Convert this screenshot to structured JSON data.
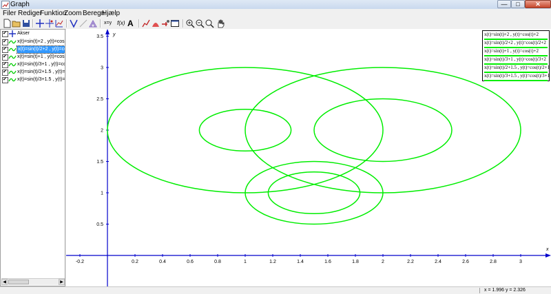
{
  "window": {
    "title": "Graph",
    "min_glyph": "—",
    "max_glyph": "□",
    "close_glyph": "✕"
  },
  "menu": [
    "Filer",
    "Rediger",
    "Funktion",
    "Zoom",
    "Beregn",
    "Hjælp"
  ],
  "toolbar": {
    "text_xy": "x=y",
    "text_fx": "f(x)",
    "text_A": "A",
    "icons": [
      "new-file-icon",
      "open-folder-icon",
      "save-icon",
      "insert-axes-icon",
      "insert-point-icon",
      "insert-series-icon",
      "insert-function-icon",
      "insert-tangent-icon",
      "insert-shading-icon",
      "insert-relation-icon",
      "insert-fx-icon",
      "insert-label-icon",
      "graph-icon",
      "area-icon",
      "pointer-icon",
      "table-icon",
      "zoom-in-icon",
      "zoom-out-icon",
      "zoom-fit-icon",
      "pan-hand-icon"
    ]
  },
  "sidebar": {
    "items": [
      {
        "label": "Akser",
        "type": "axes",
        "checked": true,
        "selected": false
      },
      {
        "label": "x(t)=sin(t)+2 , y(t)=cos(t)+2",
        "type": "function",
        "checked": true,
        "selected": false
      },
      {
        "label": "x(t)=sin(t)/2+2 , y(t)=cos(t)/2+2",
        "type": "function",
        "checked": true,
        "selected": true
      },
      {
        "label": "x(t)=sin(t)+1 , y(t)=cos(t)+2",
        "type": "function",
        "checked": true,
        "selected": false
      },
      {
        "label": "x(t)=sin(t)/3+1 , y(t)=cos(t)/3+2",
        "type": "function",
        "checked": true,
        "selected": false
      },
      {
        "label": "x(t)=sin(t)/2+1.5 , y(t)=cos(t)/2+1",
        "type": "function",
        "checked": true,
        "selected": false
      },
      {
        "label": "x(t)=sin(t)/3+1.5 , y(t)=cos(t)/3+1",
        "type": "function",
        "checked": true,
        "selected": false
      }
    ]
  },
  "legend": [
    "x(t)=sin(t)+2 , y(t)=cos(t)+2",
    "x(t)=sin(t)/2+2 , y(t)=cos(t)/2+2",
    "x(t)=sin(t)+1 , y(t)=cos(t)+2",
    "x(t)=sin(t)/3+1 , y(t)=cos(t)/3+2",
    "x(t)=sin(t)/2+1.5 , y(t)=cos(t)/2+1",
    "x(t)=sin(t)/3+1.5 , y(t)=cos(t)/3+1"
  ],
  "status": {
    "coords": "x = 1.996   y = 2.326"
  },
  "colors": {
    "curve": "#00ee00",
    "axis": "#0000cc",
    "selection": "#3399ff"
  },
  "chart_data": {
    "type": "parametric",
    "xlabel": "x",
    "ylabel": "y",
    "xlim": [
      -0.3,
      3.2
    ],
    "ylim": [
      -0.4,
      3.6
    ],
    "x_ticks": [
      "-0.2",
      "0.2",
      "0.4",
      "0.6",
      "0.8",
      "1",
      "1.2",
      "1.4",
      "1.6",
      "1.8",
      "2",
      "2.2",
      "2.4",
      "2.6",
      "2.8",
      "3"
    ],
    "y_ticks": [
      "0.5",
      "1",
      "1.5",
      "2",
      "2.5",
      "3",
      "3.5"
    ],
    "series": [
      {
        "name": "x(t)=sin(t)+2 , y(t)=cos(t)+2",
        "cx": 2,
        "cy": 2,
        "r": 1
      },
      {
        "name": "x(t)=sin(t)/2+2 , y(t)=cos(t)/2+2",
        "cx": 2,
        "cy": 2,
        "r": 0.5
      },
      {
        "name": "x(t)=sin(t)+1 , y(t)=cos(t)+2",
        "cx": 1,
        "cy": 2,
        "r": 1
      },
      {
        "name": "x(t)=sin(t)/3+1 , y(t)=cos(t)/3+2",
        "cx": 1,
        "cy": 2,
        "r": 0.333
      },
      {
        "name": "x(t)=sin(t)/2+1.5 , y(t)=cos(t)/2+1",
        "cx": 1.5,
        "cy": 1,
        "r": 0.5
      },
      {
        "name": "x(t)=sin(t)/3+1.5 , y(t)=cos(t)/3+1",
        "cx": 1.5,
        "cy": 1,
        "r": 0.333
      }
    ]
  }
}
